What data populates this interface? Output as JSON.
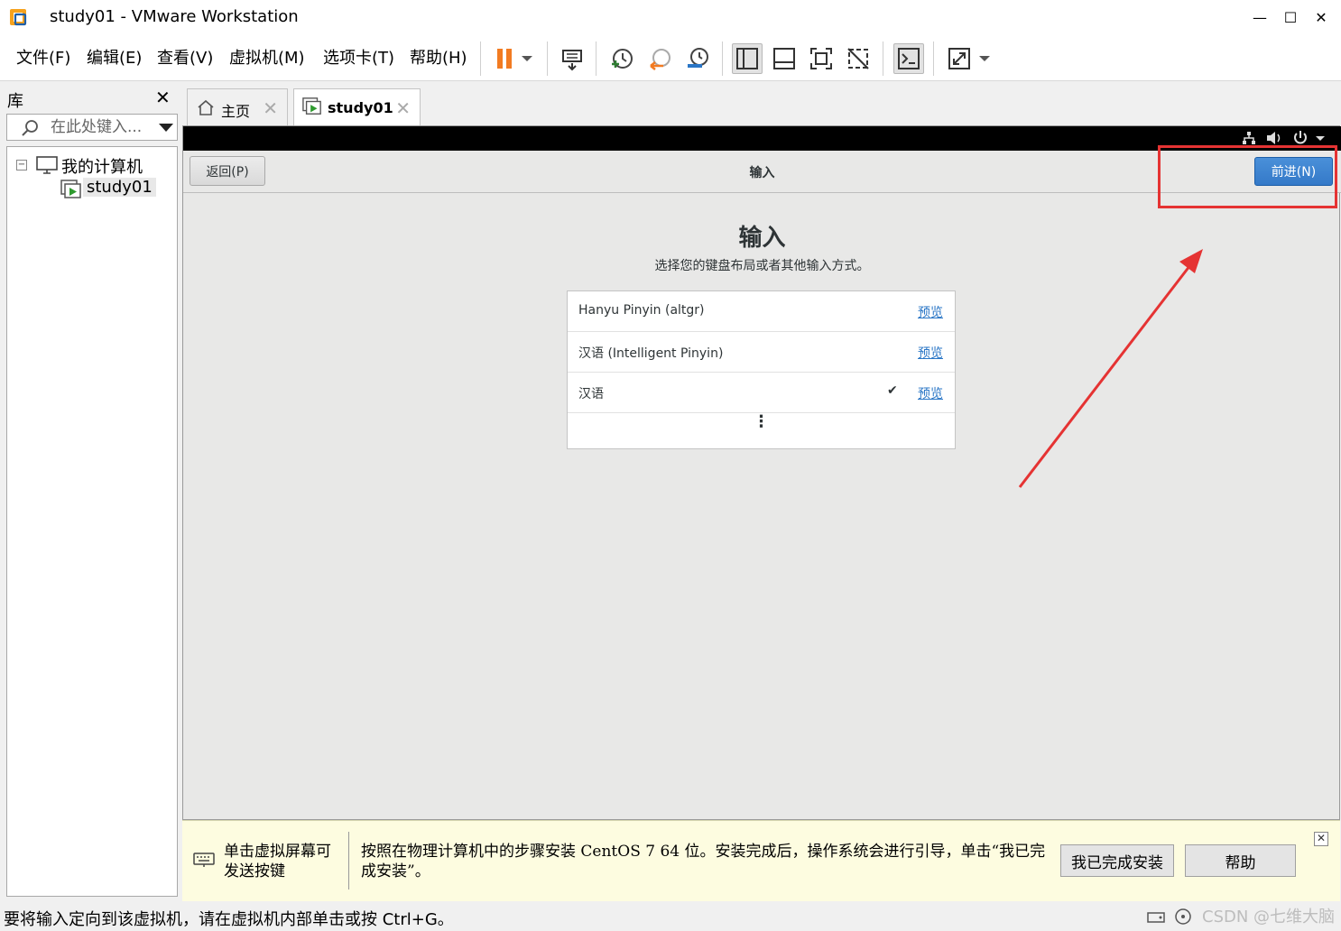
{
  "window": {
    "title": "study01 - VMware Workstation",
    "minimize_glyph": "—",
    "maximize_glyph": "☐",
    "close_glyph": "✕"
  },
  "menu": {
    "items": [
      "文件(F)",
      "编辑(E)",
      "查看(V)",
      "虚拟机(M)",
      "选项卡(T)",
      "帮助(H)"
    ]
  },
  "library": {
    "title": "库",
    "close_glyph": "✕",
    "search_placeholder": "在此处键入...",
    "tree": {
      "expander": "−",
      "root_label": "我的计算机",
      "vm_label": "study01"
    }
  },
  "tabs": [
    {
      "label": "主页",
      "close": "✕"
    },
    {
      "label": "study01",
      "close": "✕"
    }
  ],
  "vm": {
    "header": {
      "back_label": "返回(P)",
      "title": "输入",
      "next_label": "前进(N)"
    },
    "page_title": "输入",
    "page_subtitle": "选择您的键盘布局或者其他输入方式。",
    "input_methods": [
      {
        "label": "Hanyu Pinyin (altgr)",
        "link": "预览",
        "selected": false
      },
      {
        "label": "汉语 (Intelligent Pinyin)",
        "link": "预览",
        "selected": false
      },
      {
        "label": "汉语",
        "link": "预览",
        "selected": true
      }
    ],
    "check_glyph": "✔",
    "more_glyph": "⋮"
  },
  "hint_bar": {
    "click_hint": "单击虚拟屏幕可发送按键",
    "message": "按照在物理计算机中的步骤安装 CentOS 7 64 位。安装完成后，操作系统会进行引导，单击“我已完成安装”。",
    "done_button": "我已完成安装",
    "help_button": "帮助",
    "close_glyph": "✕"
  },
  "statusbar": {
    "text": "要将输入定向到该虚拟机，请在虚拟机内部单击或按 Ctrl+G。",
    "watermark": "CSDN @七维大脑"
  },
  "colors": {
    "accent_blue": "#3479c8",
    "highlight_red": "#e53333",
    "pause_orange": "#f27b22"
  }
}
